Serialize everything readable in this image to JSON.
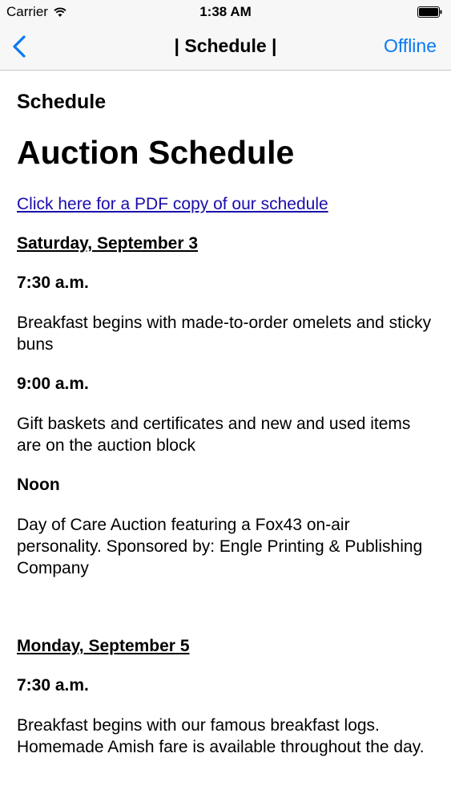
{
  "status_bar": {
    "carrier": "Carrier",
    "time": "1:38 AM"
  },
  "nav": {
    "title": "| Schedule |",
    "right_button": "Offline"
  },
  "content": {
    "section_heading": "Schedule",
    "page_title": "Auction Schedule",
    "pdf_link": "Click here for a PDF copy of our schedule",
    "days": [
      {
        "heading": "Saturday, September 3",
        "events": [
          {
            "time": "7:30 a.m.",
            "description": "Breakfast begins with made-to-order omelets and sticky buns"
          },
          {
            "time": "9:00 a.m.",
            "description": "Gift baskets and certificates and new and used items are on the auction block"
          },
          {
            "time": "Noon",
            "description": "Day of Care Auction featuring a Fox43 on-air personality. Sponsored by: Engle Printing & Publishing Company"
          }
        ]
      },
      {
        "heading": "Monday, September 5",
        "events": [
          {
            "time": "7:30 a.m.",
            "description": "Breakfast begins with our famous breakfast logs. Homemade Amish fare is available throughout the day."
          }
        ]
      }
    ]
  },
  "colors": {
    "accent": "#0a7af2",
    "link": "#1a0dab",
    "bar_background": "#f7f7f7"
  },
  "icons": {
    "wifi": "wifi-icon",
    "battery": "battery-icon",
    "back": "chevron-left-icon"
  }
}
